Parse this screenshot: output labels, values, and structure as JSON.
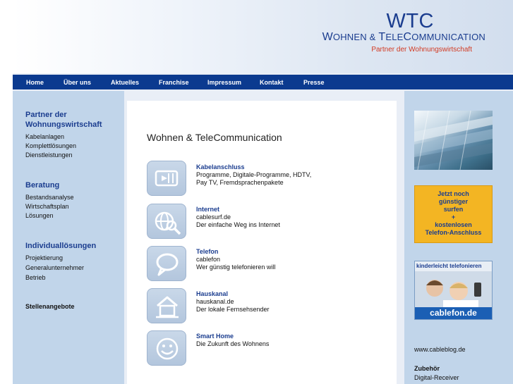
{
  "header": {
    "logo": "WTC",
    "name_w": "W",
    "name_rest1": "OHNEN & ",
    "name_t": "T",
    "name_rest2": "ELE",
    "name_c": "C",
    "name_rest3": "OMMUNICATION",
    "tagline": "Partner der Wohnungswirtschaft"
  },
  "nav": [
    "Home",
    "Über uns",
    "Aktuelles",
    "Franchise",
    "Impressum",
    "Kontakt",
    "Presse"
  ],
  "left": {
    "sections": [
      {
        "title_line1": "Partner der",
        "title_line2": "Wohnungswirtschaft",
        "items": [
          "Kabelanlagen",
          "Komplettlösungen",
          "Dienstleistungen"
        ]
      },
      {
        "title": "Beratung",
        "items": [
          "Bestandsanalyse",
          "Wirtschaftsplan",
          "Lösungen"
        ]
      },
      {
        "title": "Individuallösungen",
        "items": [
          "Projektierung",
          "Generalunternehmer",
          "Betrieb"
        ]
      }
    ],
    "stellen": "Stellenangebote"
  },
  "main": {
    "title": "Wohnen & TeleCommunication",
    "services": [
      {
        "icon": "cable-plug-icon",
        "title": "Kabelanschluss",
        "lines": [
          "Programme, Digitale-Programme, HDTV,",
          "Pay TV, Fremdsprachenpakete"
        ]
      },
      {
        "icon": "globe-search-icon",
        "title": "Internet",
        "lines": [
          "cablesurf.de",
          "Der einfache Weg ins Internet"
        ]
      },
      {
        "icon": "speech-bubble-icon",
        "title": "Telefon",
        "lines": [
          "cablefon",
          "Wer günstig telefonieren will"
        ]
      },
      {
        "icon": "house-icon",
        "title": "Hauskanal",
        "lines": [
          "hauskanal.de",
          "Der lokale Fernsehsender"
        ]
      },
      {
        "icon": "smiley-icon",
        "title": "Smart Home",
        "lines": [
          "Die Zukunft des Wohnens"
        ]
      }
    ]
  },
  "right": {
    "promo": [
      "Jetzt noch",
      "günstiger",
      "surfen",
      "+",
      "kostenlosen",
      "Telefon-Anschluss"
    ],
    "cablefon_head": "kinderleicht telefonieren",
    "cablefon_foot": "cablefon.de",
    "blog": "www.cableblog.de",
    "zubehoer": "Zubehör",
    "receiver": "Digital-Receiver"
  },
  "colors": {
    "brand_blue": "#1b3d8f",
    "nav_blue": "#0b3a8f",
    "tagline_red": "#d23a22",
    "promo_orange": "#f3b523",
    "side_blue": "#c1d5ea"
  }
}
